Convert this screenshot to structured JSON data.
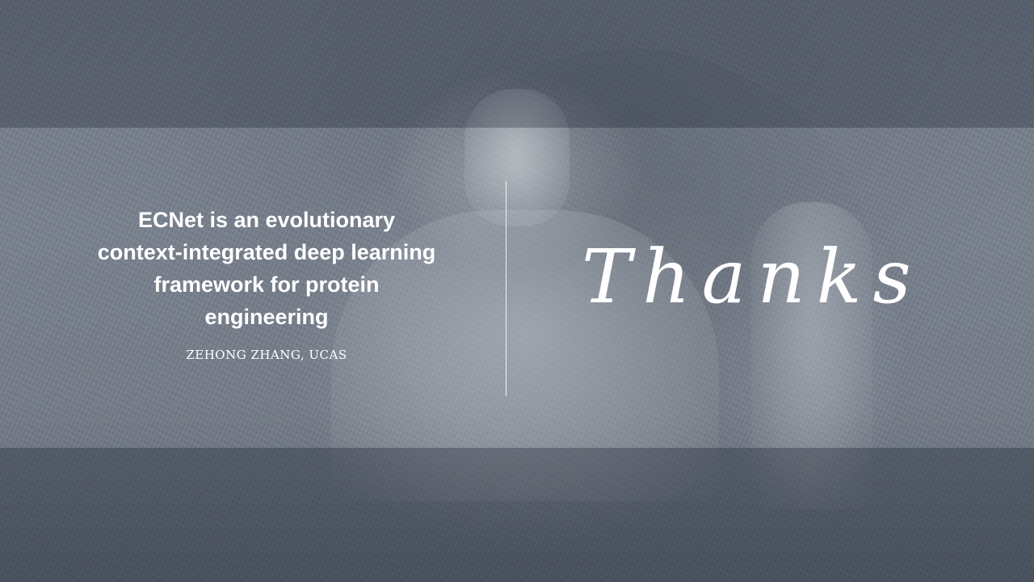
{
  "slide": {
    "title": "ECNet is an evolutionary context-integrated deep learning framework for protein engineering",
    "author": "ZEHONG ZHANG, UCAS",
    "closing": "Thanks"
  },
  "colors": {
    "text": "#ffffff",
    "background": "#6c7481",
    "band_dark": "#3a4250",
    "divider": "#ffffff"
  }
}
